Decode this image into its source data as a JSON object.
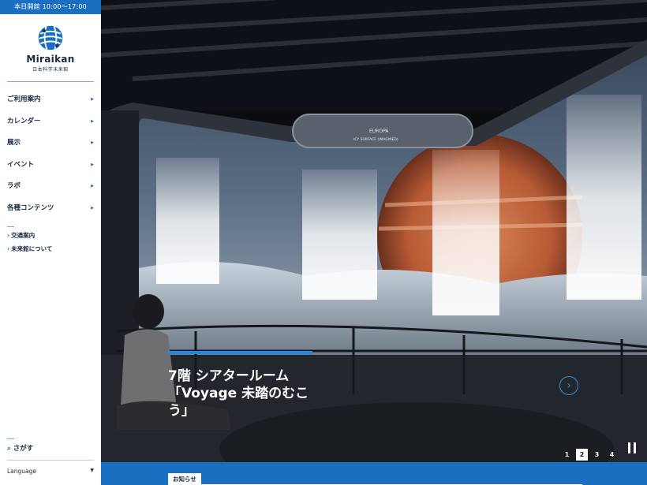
{
  "sidebar": {
    "open_hours": "本日開館  10:00〜17:00",
    "logo": {
      "name": "Miraikan",
      "subtitle": "日本科学未来館"
    },
    "nav": [
      {
        "label": "ご利用案内"
      },
      {
        "label": "カレンダー"
      },
      {
        "label": "展示"
      },
      {
        "label": "イベント"
      },
      {
        "label": "ラボ"
      },
      {
        "label": "各種コンテンツ"
      }
    ],
    "sub_links": [
      {
        "label": "交通案内"
      },
      {
        "label": "未来館について"
      }
    ],
    "search_label": "さがす",
    "language_label": "Language"
  },
  "hero": {
    "screen_text_1": "EUROPA",
    "screen_text_2": "ICY SURFACE (IMAGINED)",
    "title": "7階 シアタールーム「Voyage 未踏のむこう」",
    "pager": [
      "1",
      "2",
      "3",
      "4"
    ],
    "active_page": "2"
  },
  "notice": {
    "tab_label": "お知らせ"
  },
  "colors": {
    "brand": "#1a6fc1",
    "accent": "#1e88e5",
    "text": "#1b2a43"
  }
}
